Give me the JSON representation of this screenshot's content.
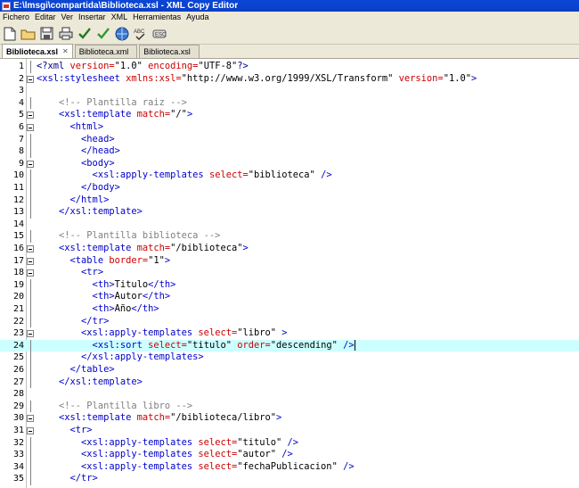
{
  "window": {
    "title": "E:\\lmsgi\\compartida\\Biblioteca.xsl - XML Copy Editor"
  },
  "menu": [
    "Fichero",
    "Editar",
    "Ver",
    "Insertar",
    "XML",
    "Herramientas",
    "Ayuda"
  ],
  "toolbar": [
    "new-file-icon",
    "open-folder-icon",
    "save-icon",
    "print-icon",
    "check-wellformed-icon",
    "validate-icon",
    "browser-icon",
    "spellcheck-icon",
    "close-icon"
  ],
  "tabs": [
    {
      "label": "Biblioteca.xsl",
      "active": true
    },
    {
      "label": "Biblioteca.xml",
      "active": false
    },
    {
      "label": "Biblioteca.xsl",
      "active": false
    }
  ],
  "current_line": 24,
  "lines": [
    {
      "n": "1",
      "segs": [
        [
          "pi",
          "<?xml "
        ],
        [
          "attr",
          "version="
        ],
        [
          "str",
          "\"1.0\" "
        ],
        [
          "attr",
          "encoding="
        ],
        [
          "str",
          "\"UTF-8\""
        ],
        [
          "pi",
          "?>"
        ]
      ]
    },
    {
      "n": "2",
      "segs": [
        [
          "tag",
          "<xsl:stylesheet "
        ],
        [
          "attr",
          "xmlns:xsl="
        ],
        [
          "str",
          "\"http://www.w3.org/1999/XSL/Transform\" "
        ],
        [
          "attr",
          "version="
        ],
        [
          "str",
          "\"1.0\""
        ],
        [
          "tag",
          ">"
        ]
      ]
    },
    {
      "n": "3",
      "segs": []
    },
    {
      "n": "4",
      "segs": [
        [
          "com",
          "    <!-- Plantilla raiz -->"
        ]
      ]
    },
    {
      "n": "5",
      "segs": [
        [
          "tag",
          "    <xsl:template "
        ],
        [
          "attr",
          "match="
        ],
        [
          "str",
          "\"/\""
        ],
        [
          "tag",
          ">"
        ]
      ]
    },
    {
      "n": "6",
      "segs": [
        [
          "tag",
          "      <html>"
        ]
      ]
    },
    {
      "n": "7",
      "segs": [
        [
          "tag",
          "        <head>"
        ]
      ]
    },
    {
      "n": "8",
      "segs": [
        [
          "tag",
          "        </head>"
        ]
      ]
    },
    {
      "n": "9",
      "segs": [
        [
          "tag",
          "        <body>"
        ]
      ]
    },
    {
      "n": "10",
      "segs": [
        [
          "tag",
          "          <xsl:apply-templates "
        ],
        [
          "attr",
          "select="
        ],
        [
          "str",
          "\"biblioteca\" "
        ],
        [
          "tag",
          "/>"
        ]
      ]
    },
    {
      "n": "11",
      "segs": [
        [
          "tag",
          "        </body>"
        ]
      ]
    },
    {
      "n": "12",
      "segs": [
        [
          "tag",
          "      </html>"
        ]
      ]
    },
    {
      "n": "13",
      "segs": [
        [
          "tag",
          "    </xsl:template>"
        ]
      ]
    },
    {
      "n": "14",
      "segs": []
    },
    {
      "n": "15",
      "segs": [
        [
          "com",
          "    <!-- Plantilla biblioteca -->"
        ]
      ]
    },
    {
      "n": "16",
      "segs": [
        [
          "tag",
          "    <xsl:template "
        ],
        [
          "attr",
          "match="
        ],
        [
          "str",
          "\"/biblioteca\""
        ],
        [
          "tag",
          ">"
        ]
      ]
    },
    {
      "n": "17",
      "segs": [
        [
          "tag",
          "      <table "
        ],
        [
          "attr",
          "border="
        ],
        [
          "str",
          "\"1\""
        ],
        [
          "tag",
          ">"
        ]
      ]
    },
    {
      "n": "18",
      "segs": [
        [
          "tag",
          "        <tr>"
        ]
      ]
    },
    {
      "n": "19",
      "segs": [
        [
          "tag",
          "          <th>"
        ],
        [
          "str",
          "Titulo"
        ],
        [
          "tag",
          "</th>"
        ]
      ]
    },
    {
      "n": "20",
      "segs": [
        [
          "tag",
          "          <th>"
        ],
        [
          "str",
          "Autor"
        ],
        [
          "tag",
          "</th>"
        ]
      ]
    },
    {
      "n": "21",
      "segs": [
        [
          "tag",
          "          <th>"
        ],
        [
          "str",
          "Año"
        ],
        [
          "tag",
          "</th>"
        ]
      ]
    },
    {
      "n": "22",
      "segs": [
        [
          "tag",
          "        </tr>"
        ]
      ]
    },
    {
      "n": "23",
      "segs": [
        [
          "tag",
          "        <xsl:apply-templates "
        ],
        [
          "attr",
          "select="
        ],
        [
          "str",
          "\"libro\" "
        ],
        [
          "tag",
          ">"
        ]
      ]
    },
    {
      "n": "24",
      "segs": [
        [
          "tag",
          "          <xsl:sort "
        ],
        [
          "attr",
          "select="
        ],
        [
          "str",
          "\"titulo\" "
        ],
        [
          "attr",
          "order="
        ],
        [
          "str",
          "\"descending\" "
        ],
        [
          "tag",
          "/>"
        ]
      ]
    },
    {
      "n": "25",
      "segs": [
        [
          "tag",
          "        </xsl:apply-templates>"
        ]
      ]
    },
    {
      "n": "26",
      "segs": [
        [
          "tag",
          "      </table>"
        ]
      ]
    },
    {
      "n": "27",
      "segs": [
        [
          "tag",
          "    </xsl:template>"
        ]
      ]
    },
    {
      "n": "28",
      "segs": []
    },
    {
      "n": "29",
      "segs": [
        [
          "com",
          "    <!-- Plantilla libro -->"
        ]
      ]
    },
    {
      "n": "30",
      "segs": [
        [
          "tag",
          "    <xsl:template "
        ],
        [
          "attr",
          "match="
        ],
        [
          "str",
          "\"/biblioteca/libro\""
        ],
        [
          "tag",
          ">"
        ]
      ]
    },
    {
      "n": "31",
      "segs": [
        [
          "tag",
          "      <tr>"
        ]
      ]
    },
    {
      "n": "32",
      "segs": [
        [
          "tag",
          "        <xsl:apply-templates "
        ],
        [
          "attr",
          "select="
        ],
        [
          "str",
          "\"titulo\" "
        ],
        [
          "tag",
          "/>"
        ]
      ]
    },
    {
      "n": "33",
      "segs": [
        [
          "tag",
          "        <xsl:apply-templates "
        ],
        [
          "attr",
          "select="
        ],
        [
          "str",
          "\"autor\" "
        ],
        [
          "tag",
          "/>"
        ]
      ]
    },
    {
      "n": "34",
      "segs": [
        [
          "tag",
          "        <xsl:apply-templates "
        ],
        [
          "attr",
          "select="
        ],
        [
          "str",
          "\"fechaPublicacion\" "
        ],
        [
          "tag",
          "/>"
        ]
      ]
    },
    {
      "n": "35",
      "segs": [
        [
          "tag",
          "      </tr>"
        ]
      ]
    }
  ],
  "fold_lines": [
    "2",
    "5",
    "6",
    "9",
    "16",
    "17",
    "18",
    "23",
    "30",
    "31"
  ]
}
